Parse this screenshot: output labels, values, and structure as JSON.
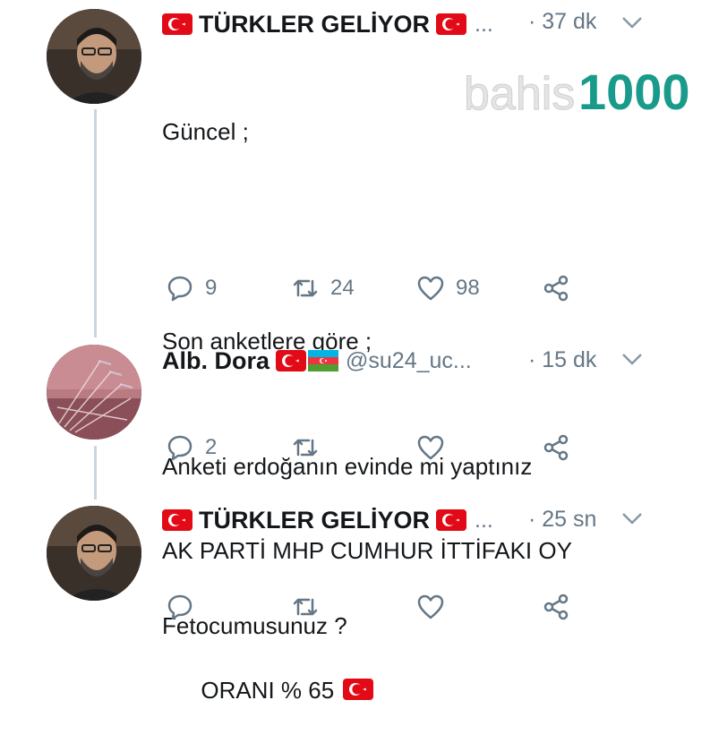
{
  "watermark": {
    "prefix": "bahis",
    "suffix": "1000"
  },
  "tweets": [
    {
      "name": "TÜRKLER GELİYOR",
      "ellipsis": "...",
      "time": "· 37 dk",
      "text_lines": [
        "Güncel ;",
        "",
        "Son anketlere göre ;",
        "",
        "AK PARTİ MHP CUMHUR İTTİFAKI OY",
        "ORANI % 65"
      ],
      "counts": {
        "reply": "9",
        "retweet": "24",
        "like": "98"
      }
    },
    {
      "name": "Alb. Dora",
      "handle": "@su24_uc...",
      "time": "· 15 dk",
      "text_lines": [
        "Anketi erdoğanın evinde mi yaptınız"
      ],
      "counts": {
        "reply": "2",
        "retweet": "",
        "like": ""
      }
    },
    {
      "name": "TÜRKLER GELİYOR",
      "ellipsis": "...",
      "time": "· 25 sn",
      "text_lines": [
        "Fetocumusunuz ?"
      ],
      "counts": {
        "reply": "",
        "retweet": "",
        "like": ""
      }
    }
  ],
  "icons": [
    "reply-icon",
    "retweet-icon",
    "like-icon",
    "share-icon",
    "chevron-down-icon",
    "turkey-flag-icon",
    "azerbaijan-flag-icon"
  ],
  "colors": {
    "text": "#14171a",
    "secondary": "#657786",
    "thread_line": "#ccd6dd",
    "flag_red": "#e30a17",
    "watermark_teal": "#1a9a8a"
  }
}
